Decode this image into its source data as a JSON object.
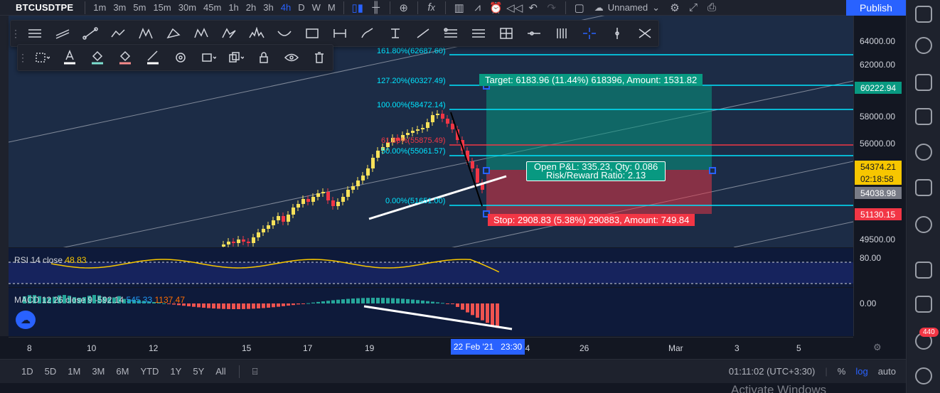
{
  "topbar": {
    "symbol": "BTCUSDTPE",
    "timeframes": [
      "1m",
      "3m",
      "5m",
      "15m",
      "30m",
      "45m",
      "1h",
      "2h",
      "3h",
      "4h",
      "D",
      "W",
      "M"
    ],
    "active_timeframe": "4h",
    "layout_name": "Unnamed",
    "publish_label": "Publish",
    "icons": [
      "candles-icon",
      "indicators-icon",
      "add-icon",
      "fx-icon",
      "bars-icon",
      "templates-icon",
      "alert-icon",
      "replay-icon",
      "undo-icon",
      "redo-icon",
      "fullscreen-icon",
      "cloud-icon",
      "settings-icon",
      "expand-icon",
      "camera-icon"
    ]
  },
  "price_scale": {
    "labels": [
      "64000.00",
      "62000.00",
      "58000.00",
      "56000.00",
      "49500.00"
    ],
    "tags": [
      {
        "text": "60222.94",
        "bg": "#089981",
        "color": "#ffffff"
      },
      {
        "text": "54374.21",
        "bg": "#f7c600",
        "color": "#131722"
      },
      {
        "text": "02:18:58",
        "bg": "#f7c600",
        "color": "#131722"
      },
      {
        "text": "54038.98",
        "bg": "#787b86",
        "color": "#ffffff"
      },
      {
        "text": "51130.15",
        "bg": "#f23645",
        "color": "#ffffff"
      }
    ],
    "rsi_labels": [
      "80.00"
    ],
    "macd_labels": [
      "0.00"
    ]
  },
  "fib": [
    {
      "label": "161.80%(62687.60)"
    },
    {
      "label": "127.20%(60327.49)"
    },
    {
      "label": "100.00%(58472.14)"
    },
    {
      "label": "61.80%(55875.49)"
    },
    {
      "label": "50.00%(55061.57)"
    },
    {
      "label": "0.00%(51651.00)"
    }
  ],
  "position": {
    "target": "Target: 6183.96 (11.44%) 618396, Amount: 1531.82",
    "pnl_line1": "Open P&L: 335.23, Qty: 0.086",
    "pnl_line2": "Risk/Reward Ratio: 2.13",
    "stop": "Stop: 2908.83 (5.38%) 290883, Amount: 749.84"
  },
  "rsi": {
    "name": "RSI 14 close",
    "value": "48.83"
  },
  "macd": {
    "name": "MACD 12 26 close 9",
    "v1": "-592.14",
    "v2": "545.33",
    "v3": "1137.47"
  },
  "time_axis": {
    "labels": [
      "8",
      "10",
      "12",
      "15",
      "17",
      "19",
      "24",
      "26",
      "Mar",
      "3",
      "5"
    ],
    "current_date": "22 Feb '21",
    "current_time": "23:30"
  },
  "bottombar": {
    "ranges": [
      "1D",
      "5D",
      "1M",
      "3M",
      "6M",
      "YTD",
      "1Y",
      "5Y",
      "All"
    ],
    "clock": "01:11:02 (UTC+3:30)",
    "percent": "%",
    "log": "log",
    "auto": "auto"
  },
  "watermark": "Activate Windows",
  "notification_count": "440",
  "colors": {
    "accent": "#2962ff",
    "fib": "#00e5ff",
    "profit_zone": "#089981",
    "loss_zone": "#f23645",
    "bull_candle": "#f7e15a",
    "bear_candle": "#f23645"
  }
}
